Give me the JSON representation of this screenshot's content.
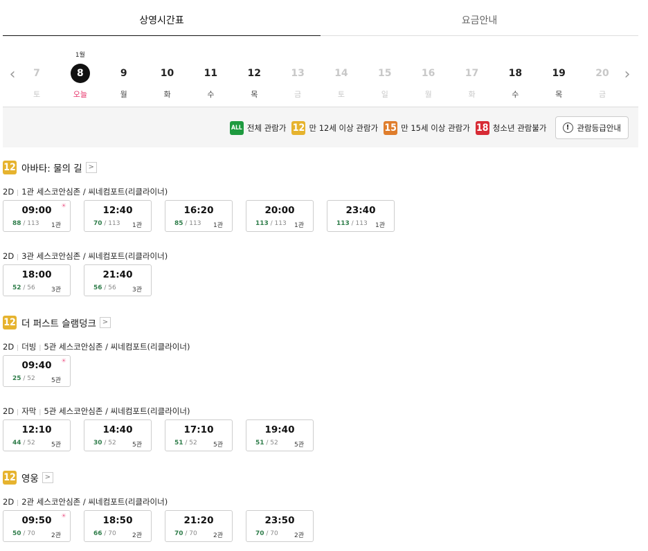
{
  "tabs": [
    {
      "label": "상영시간표",
      "active": true
    },
    {
      "label": "요금안내",
      "active": false
    }
  ],
  "dates": {
    "prev_arrow": "‹",
    "next_arrow": "›",
    "days": [
      {
        "num": "7",
        "dow": "토",
        "state": "disabled"
      },
      {
        "num": "8",
        "dow": "오늘",
        "month": "1월",
        "state": "selected"
      },
      {
        "num": "9",
        "dow": "월",
        "state": "normal"
      },
      {
        "num": "10",
        "dow": "화",
        "state": "normal"
      },
      {
        "num": "11",
        "dow": "수",
        "state": "normal"
      },
      {
        "num": "12",
        "dow": "목",
        "state": "normal"
      },
      {
        "num": "13",
        "dow": "금",
        "state": "disabled"
      },
      {
        "num": "14",
        "dow": "토",
        "state": "disabled"
      },
      {
        "num": "15",
        "dow": "일",
        "state": "disabled"
      },
      {
        "num": "16",
        "dow": "월",
        "state": "disabled"
      },
      {
        "num": "17",
        "dow": "화",
        "state": "disabled"
      },
      {
        "num": "18",
        "dow": "수",
        "state": "normal"
      },
      {
        "num": "19",
        "dow": "목",
        "state": "normal"
      },
      {
        "num": "20",
        "dow": "금",
        "state": "disabled"
      }
    ]
  },
  "legend": {
    "items": [
      {
        "badge": "ALL",
        "cls": "all",
        "label": "전체 관람가"
      },
      {
        "badge": "12",
        "cls": "r12",
        "label": "만 12세 이상 관람가"
      },
      {
        "badge": "15",
        "cls": "r15",
        "label": "만 15세 이상 관람가"
      },
      {
        "badge": "18",
        "cls": "r18",
        "label": "청소년 관람불가"
      }
    ],
    "guide_icon": "!",
    "guide_label": "관람등급안내"
  },
  "movies": [
    {
      "rating": "12",
      "title": "아바타: 물의 길",
      "more": ">",
      "groups": [
        {
          "info": [
            "2D",
            "1관 세스코안심존 / 씨네컴포트(리클라이너)"
          ],
          "times": [
            {
              "time": "09:00",
              "avail": "88",
              "total": "113",
              "hall": "1관",
              "morning": true
            },
            {
              "time": "12:40",
              "avail": "70",
              "total": "113",
              "hall": "1관"
            },
            {
              "time": "16:20",
              "avail": "85",
              "total": "113",
              "hall": "1관"
            },
            {
              "time": "20:00",
              "avail": "113",
              "total": "113",
              "hall": "1관"
            },
            {
              "time": "23:40",
              "avail": "113",
              "total": "113",
              "hall": "1관"
            }
          ]
        },
        {
          "info": [
            "2D",
            "3관 세스코안심존 / 씨네컴포트(리클라이너)"
          ],
          "times": [
            {
              "time": "18:00",
              "avail": "52",
              "total": "56",
              "hall": "3관"
            },
            {
              "time": "21:40",
              "avail": "56",
              "total": "56",
              "hall": "3관"
            }
          ]
        }
      ]
    },
    {
      "rating": "12",
      "title": "더 퍼스트 슬램덩크",
      "more": ">",
      "groups": [
        {
          "info": [
            "2D",
            "더빙",
            "5관 세스코안심존 / 씨네컴포트(리클라이너)"
          ],
          "times": [
            {
              "time": "09:40",
              "avail": "25",
              "total": "52",
              "hall": "5관",
              "morning": true
            }
          ]
        },
        {
          "info": [
            "2D",
            "자막",
            "5관 세스코안심존 / 씨네컴포트(리클라이너)"
          ],
          "times": [
            {
              "time": "12:10",
              "avail": "44",
              "total": "52",
              "hall": "5관"
            },
            {
              "time": "14:40",
              "avail": "30",
              "total": "52",
              "hall": "5관"
            },
            {
              "time": "17:10",
              "avail": "51",
              "total": "52",
              "hall": "5관"
            },
            {
              "time": "19:40",
              "avail": "51",
              "total": "52",
              "hall": "5관"
            }
          ]
        }
      ]
    },
    {
      "rating": "12",
      "title": "영웅",
      "more": ">",
      "groups": [
        {
          "info": [
            "2D",
            "2관 세스코안심존 / 씨네컴포트(리클라이너)"
          ],
          "times": [
            {
              "time": "09:50",
              "avail": "50",
              "total": "70",
              "hall": "2관",
              "morning": true
            },
            {
              "time": "18:50",
              "avail": "66",
              "total": "70",
              "hall": "2관"
            },
            {
              "time": "21:20",
              "avail": "70",
              "total": "70",
              "hall": "2관"
            },
            {
              "time": "23:50",
              "avail": "70",
              "total": "70",
              "hall": "2관"
            }
          ]
        }
      ]
    }
  ],
  "morning_icon": "☀"
}
